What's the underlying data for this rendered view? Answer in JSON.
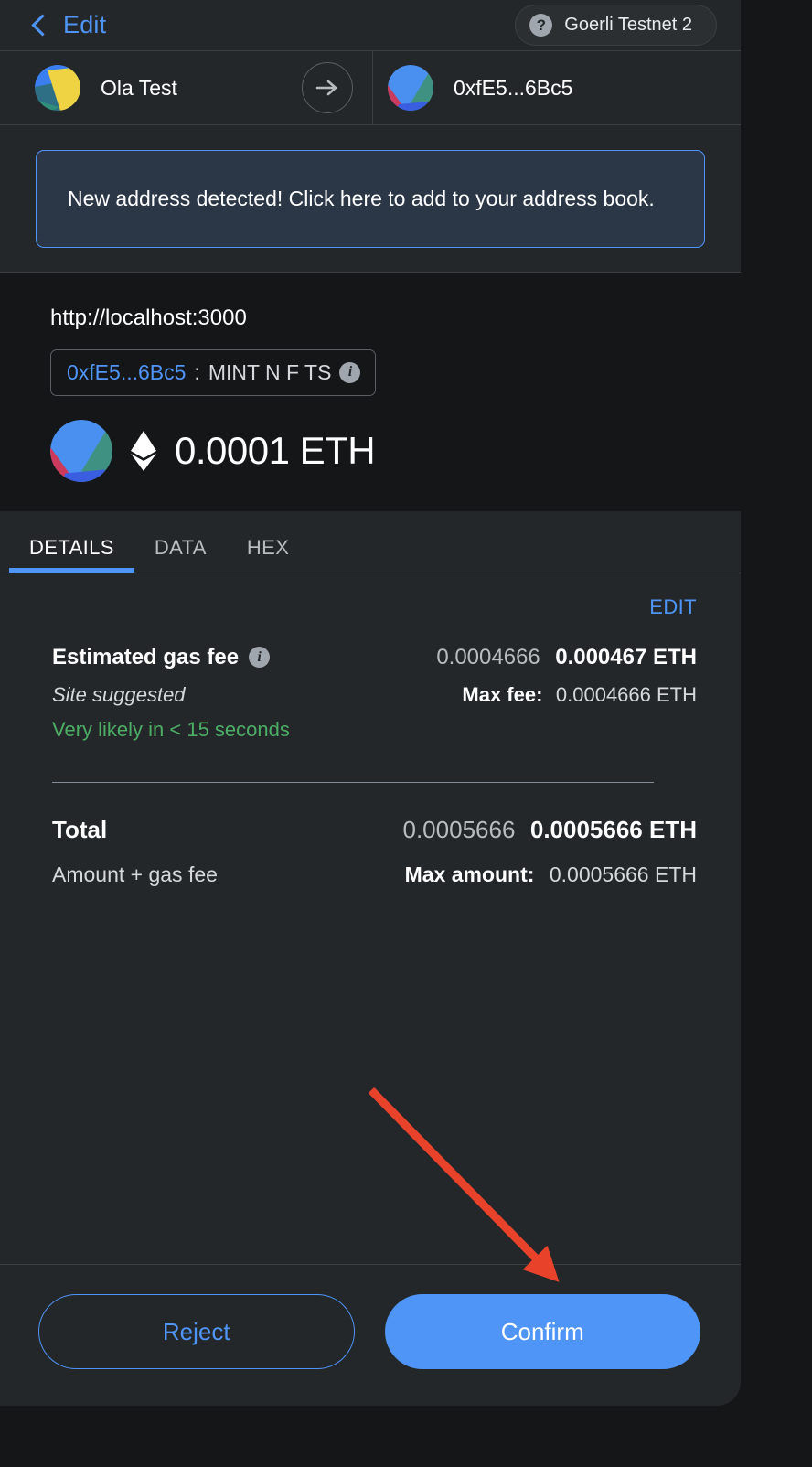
{
  "header": {
    "back_label": "Edit",
    "back_icon": "chevron-left-icon",
    "network_icon": "question-mark-icon",
    "network_name": "Goerli Testnet 2"
  },
  "accounts": {
    "from_name": "Ola Test",
    "from_avatar": "jazzicon-blue-yellow",
    "arrow_icon": "arrow-right-icon",
    "to_name": "0xfE5...6Bc5",
    "to_avatar": "jazzicon-blue-green-pink"
  },
  "banner": {
    "text": "New address detected! Click here to add to your address book."
  },
  "origin": {
    "url": "http://localhost:3000",
    "contract_address": "0xfE5...6Bc5",
    "separator": ":",
    "contract_name": "MINT N F TS",
    "info_icon": "info-icon",
    "info_glyph": "i"
  },
  "amount": {
    "avatar": "jazzicon-blue-green-pink",
    "currency_icon": "ethereum-diamond-icon",
    "value": "0.0001 ETH"
  },
  "tabs": [
    {
      "label": "DETAILS",
      "active": true
    },
    {
      "label": "DATA",
      "active": false
    },
    {
      "label": "HEX",
      "active": false
    }
  ],
  "details": {
    "edit_label": "EDIT",
    "gas_fee_label": "Estimated gas fee",
    "gas_fee_info_icon": "info-icon",
    "gas_fee_info_glyph": "i",
    "gas_fee_fiat": "0.0004666",
    "gas_fee_native": "0.000467 ETH",
    "site_suggested": "Site suggested",
    "max_fee_label": "Max fee:",
    "max_fee_value": "0.0004666 ETH",
    "speed_text": "Very likely in < 15 seconds",
    "total_label": "Total",
    "total_fiat": "0.0005666",
    "total_native": "0.0005666 ETH",
    "amount_gas_label": "Amount + gas fee",
    "max_amount_label": "Max amount:",
    "max_amount_value": "0.0005666 ETH"
  },
  "footer": {
    "reject_label": "Reject",
    "confirm_label": "Confirm"
  },
  "annotation": {
    "type": "arrow",
    "color": "#e8432a",
    "points_to": "confirm-button"
  },
  "colors": {
    "accent_blue": "#4f94f7",
    "success_green": "#4cae65",
    "panel_bg": "#24272a",
    "page_bg": "#141618",
    "banner_bg": "#2b3746",
    "annotation_red": "#e8432a"
  }
}
